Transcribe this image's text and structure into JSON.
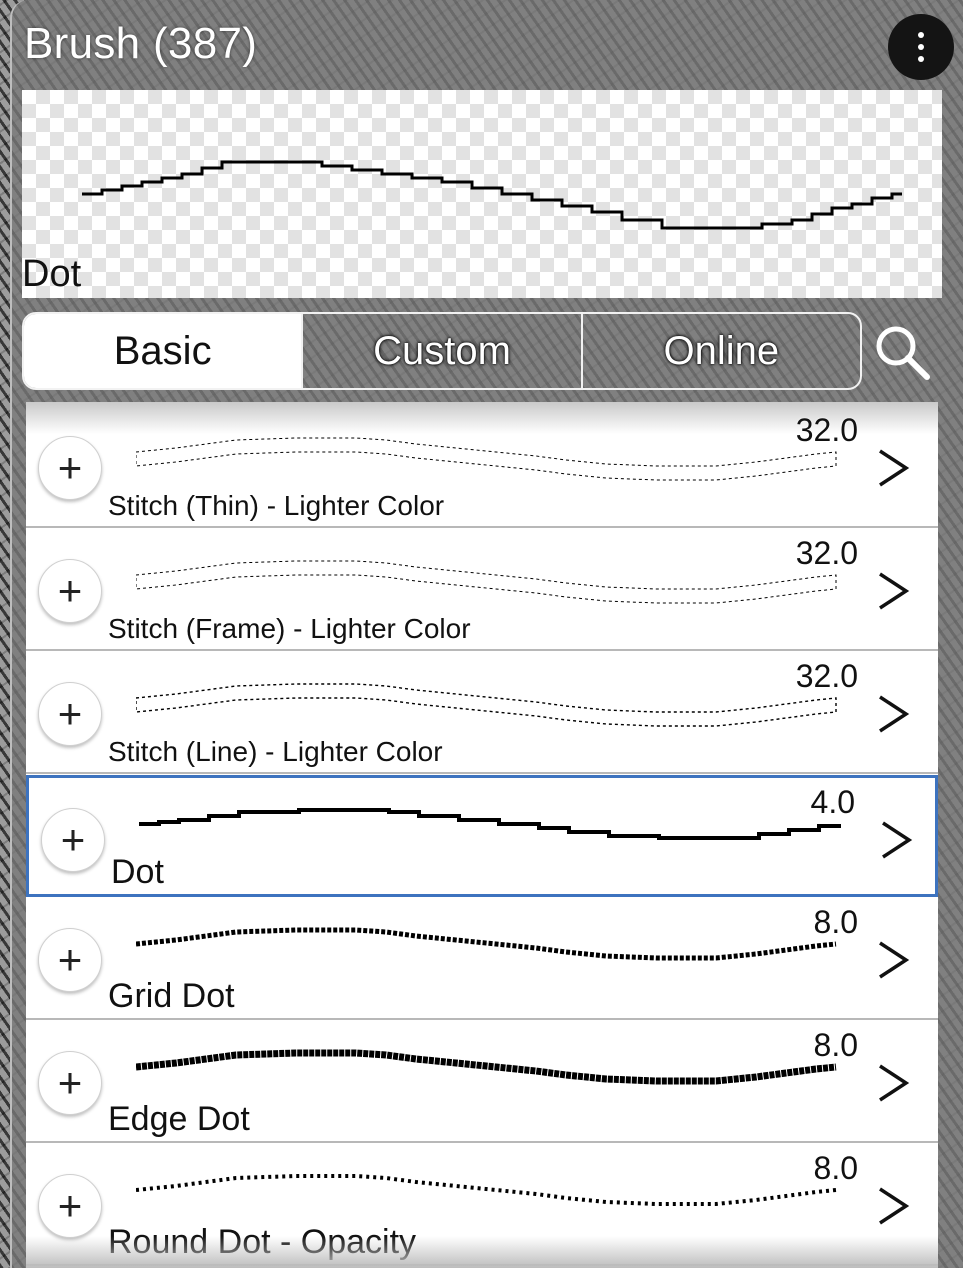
{
  "header": {
    "title": "Brush (387)",
    "menu_icon": "more-vertical-icon"
  },
  "preview": {
    "brush_name": "Dot"
  },
  "tabs": [
    {
      "label": "Basic",
      "active": true
    },
    {
      "label": "Custom",
      "active": false
    },
    {
      "label": "Online",
      "active": false
    }
  ],
  "search_icon": "search-icon",
  "brushes": [
    {
      "name": "Stitch (Thin) - Lighter Color",
      "size": "32.0",
      "style": "stitch-thin",
      "selected": false
    },
    {
      "name": "Stitch (Frame) - Lighter Color",
      "size": "32.0",
      "style": "stitch-frame",
      "selected": false
    },
    {
      "name": "Stitch (Line) - Lighter Color",
      "size": "32.0",
      "style": "stitch-line",
      "selected": false
    },
    {
      "name": "Dot",
      "size": "4.0",
      "style": "dot",
      "selected": true
    },
    {
      "name": "Grid Dot",
      "size": "8.0",
      "style": "grid-dot",
      "selected": false
    },
    {
      "name": "Edge Dot",
      "size": "8.0",
      "style": "edge-dot",
      "selected": false
    },
    {
      "name": "Round Dot - Opacity",
      "size": "8.0",
      "style": "round-dot",
      "selected": false
    }
  ],
  "colors": {
    "selection_border": "#3d73bf",
    "tab_active_bg": "#ffffff"
  }
}
